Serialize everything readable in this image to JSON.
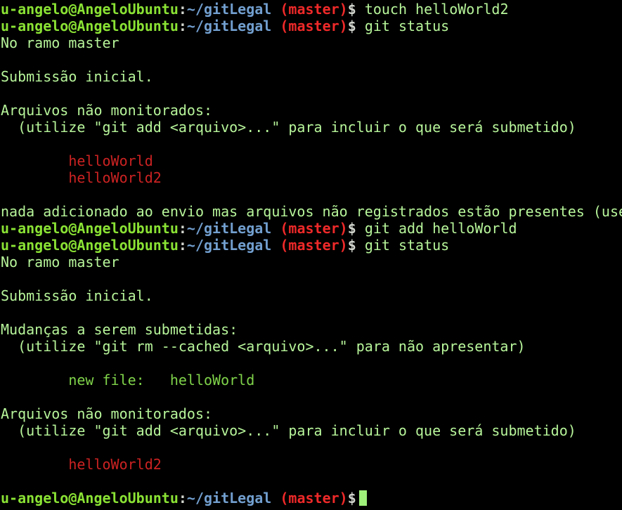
{
  "prompt": {
    "user_host": "u-angelo@AngeloUbuntu",
    "colon": ":",
    "path": "~/gitLegal",
    "branch": "(master)",
    "dollar": "$"
  },
  "commands": {
    "c1": "touch helloWorld2",
    "c2": "git status",
    "c3": "git add helloWorld",
    "c4": "git status"
  },
  "output": {
    "on_branch": "No ramo master",
    "initial_commit": "Submissão inicial.",
    "untracked_header": "Arquivos não monitorados:",
    "untracked_hint": "  (utilize \"git add <arquivo>...\" para incluir o que será submetido)",
    "untracked_file_1": "        helloWorld",
    "untracked_file_2": "        helloWorld2",
    "nothing_added": "nada adicionado ao envio mas arquivos não registrados estão presentes (use",
    "staged_header": "Mudanças a serem submetidas:",
    "staged_hint": "  (utilize \"git rm --cached <arquivo>...\" para não apresentar)",
    "new_file_label": "        new file:   helloWorld",
    "untracked_file_3": "        helloWorld2"
  },
  "colors": {
    "background": "#000000",
    "text": "#b7f59a",
    "user_host": "#8ae234",
    "path": "#729fcf",
    "branch": "#ef2929",
    "untracked": "#cc2222",
    "staged": "#7fd34a",
    "cursor": "#9ef07a"
  }
}
